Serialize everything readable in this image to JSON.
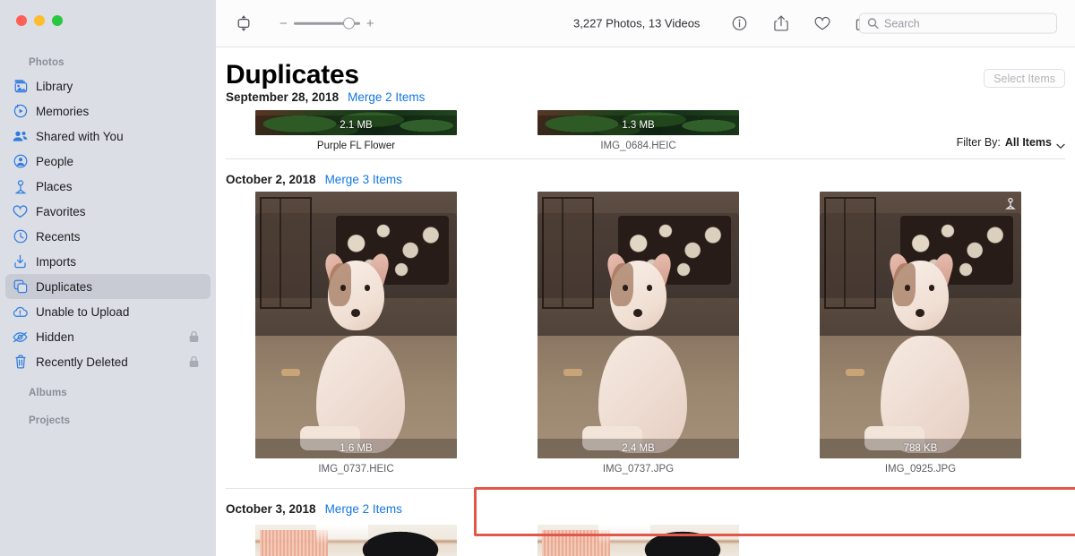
{
  "window": {
    "traffic_lights": [
      "close",
      "minimize",
      "zoom"
    ],
    "colors": {
      "sidebar_bg": "#DCDEE6",
      "toolbar_bg": "#FCFCFD",
      "accent_blue": "#1277E2",
      "sidebar_icon_blue": "#2F7CE0",
      "annotation_red": "#E2574C",
      "selected_row": "#C9CBD4"
    }
  },
  "sidebar": {
    "sections": [
      {
        "label": "Photos"
      },
      {
        "label": "Albums"
      },
      {
        "label": "Projects"
      }
    ],
    "items": [
      {
        "label": "Library",
        "icon": "library-icon",
        "selected": false,
        "locked": false
      },
      {
        "label": "Memories",
        "icon": "memories-icon",
        "selected": false,
        "locked": false
      },
      {
        "label": "Shared with You",
        "icon": "shared-with-you-icon",
        "selected": false,
        "locked": false
      },
      {
        "label": "People",
        "icon": "people-icon",
        "selected": false,
        "locked": false
      },
      {
        "label": "Places",
        "icon": "places-pin-icon",
        "selected": false,
        "locked": false
      },
      {
        "label": "Favorites",
        "icon": "heart-icon",
        "selected": false,
        "locked": false
      },
      {
        "label": "Recents",
        "icon": "clock-icon",
        "selected": false,
        "locked": false
      },
      {
        "label": "Imports",
        "icon": "import-download-icon",
        "selected": false,
        "locked": false
      },
      {
        "label": "Duplicates",
        "icon": "duplicates-icon",
        "selected": true,
        "locked": false
      },
      {
        "label": "Unable to Upload",
        "icon": "cloud-warning-icon",
        "selected": false,
        "locked": false
      },
      {
        "label": "Hidden",
        "icon": "eye-slash-icon",
        "selected": false,
        "locked": true
      },
      {
        "label": "Recently Deleted",
        "icon": "trash-icon",
        "selected": false,
        "locked": true
      }
    ]
  },
  "toolbar": {
    "sidebar_toggle_icon": "sidebar-toggle-icon",
    "zoom_out_label": "−",
    "zoom_in_label": "+",
    "zoom_value": 78,
    "count_label": "3,227 Photos, 13 Videos",
    "icons": [
      {
        "name": "info-icon"
      },
      {
        "name": "share-icon"
      },
      {
        "name": "heart-icon"
      },
      {
        "name": "rotate-icon"
      }
    ],
    "search": {
      "placeholder": "Search",
      "value": "",
      "icon": "search-icon"
    }
  },
  "content": {
    "page_title": "Duplicates",
    "select_items_label": "Select Items",
    "select_items_disabled": true,
    "filter": {
      "prefix": "Filter By:",
      "value": "All Items",
      "chevron_icon": "chevron-down-icon"
    },
    "groups": [
      {
        "date": "September 28, 2018",
        "merge_label": "Merge 2 Items",
        "partial": true,
        "photos": [
          {
            "size": "2.1 MB",
            "name": "Purple FL Flower",
            "art": "leaf",
            "name_dark": true,
            "pin": false
          },
          {
            "size": "1.3 MB",
            "name": "IMG_0684.HEIC",
            "art": "leaf",
            "name_dark": false,
            "pin": false
          }
        ]
      },
      {
        "date": "October 2, 2018",
        "merge_label": "Merge 3 Items",
        "partial": false,
        "photos": [
          {
            "size": "1.6 MB",
            "name": "IMG_0737.HEIC",
            "art": "dog",
            "name_dark": false,
            "pin": false
          },
          {
            "size": "2.4 MB",
            "name": "IMG_0737.JPG",
            "art": "dog",
            "name_dark": false,
            "pin": false
          },
          {
            "size": "788 KB",
            "name": "IMG_0925.JPG",
            "art": "dog",
            "name_dark": false,
            "pin": true
          }
        ]
      },
      {
        "date": "October 3, 2018",
        "merge_label": "Merge 2 Items",
        "partial": true,
        "photos": [
          {
            "size": "",
            "name": "",
            "art": "room",
            "name_dark": false,
            "pin": false
          },
          {
            "size": "",
            "name": "",
            "art": "room",
            "name_dark": false,
            "pin": false
          }
        ]
      }
    ],
    "annotation": {
      "shape": "rectangle",
      "color": "#E2574C"
    }
  }
}
